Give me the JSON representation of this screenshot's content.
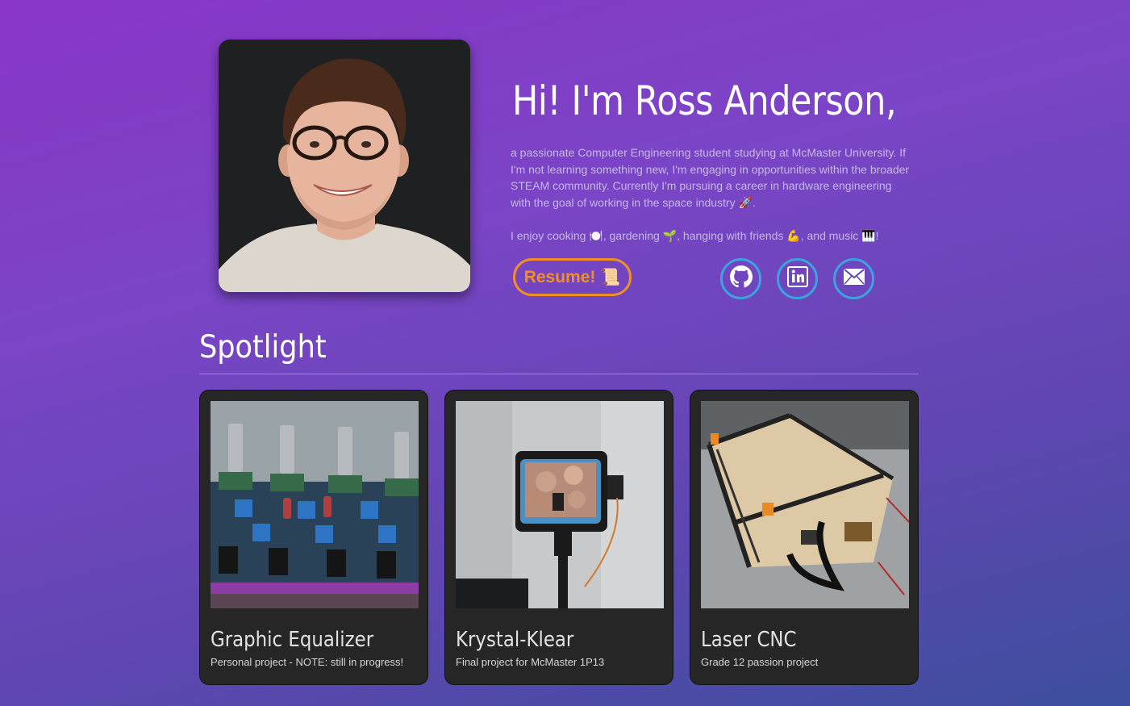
{
  "profile": {
    "headline": "Hi! I'm Ross Anderson,",
    "bio_1": "a passionate Computer Engineering student studying at McMaster University. If I'm not learning something new, I'm engaging in opportunities within the broader STEAM community. Currently I'm pursuing a career in hardware engineering with the goal of working in the space industry 🚀.",
    "bio_2": "I enjoy cooking 🍽️, gardening 🌱, hanging with friends 💪, and music 🎹!",
    "resume_label": "Resume!",
    "resume_icon": "📜"
  },
  "social": {
    "github_icon": "github-icon",
    "linkedin_icon": "linkedin-icon",
    "email_icon": "email-icon",
    "accent": "#3aa4e0"
  },
  "spotlight": {
    "title": "Spotlight",
    "cards": [
      {
        "title": "Graphic Equalizer",
        "subtitle": "Personal project - NOTE: still in progress!"
      },
      {
        "title": "Krystal-Klear",
        "subtitle": "Final project for McMaster 1P13"
      },
      {
        "title": "Laser CNC",
        "subtitle": "Grade 12 passion project"
      }
    ]
  },
  "colors": {
    "resume_accent": "#f28f24",
    "card_bg": "#262626",
    "bg_top": "#8a36c8",
    "bg_bottom": "#3d4f9e"
  }
}
